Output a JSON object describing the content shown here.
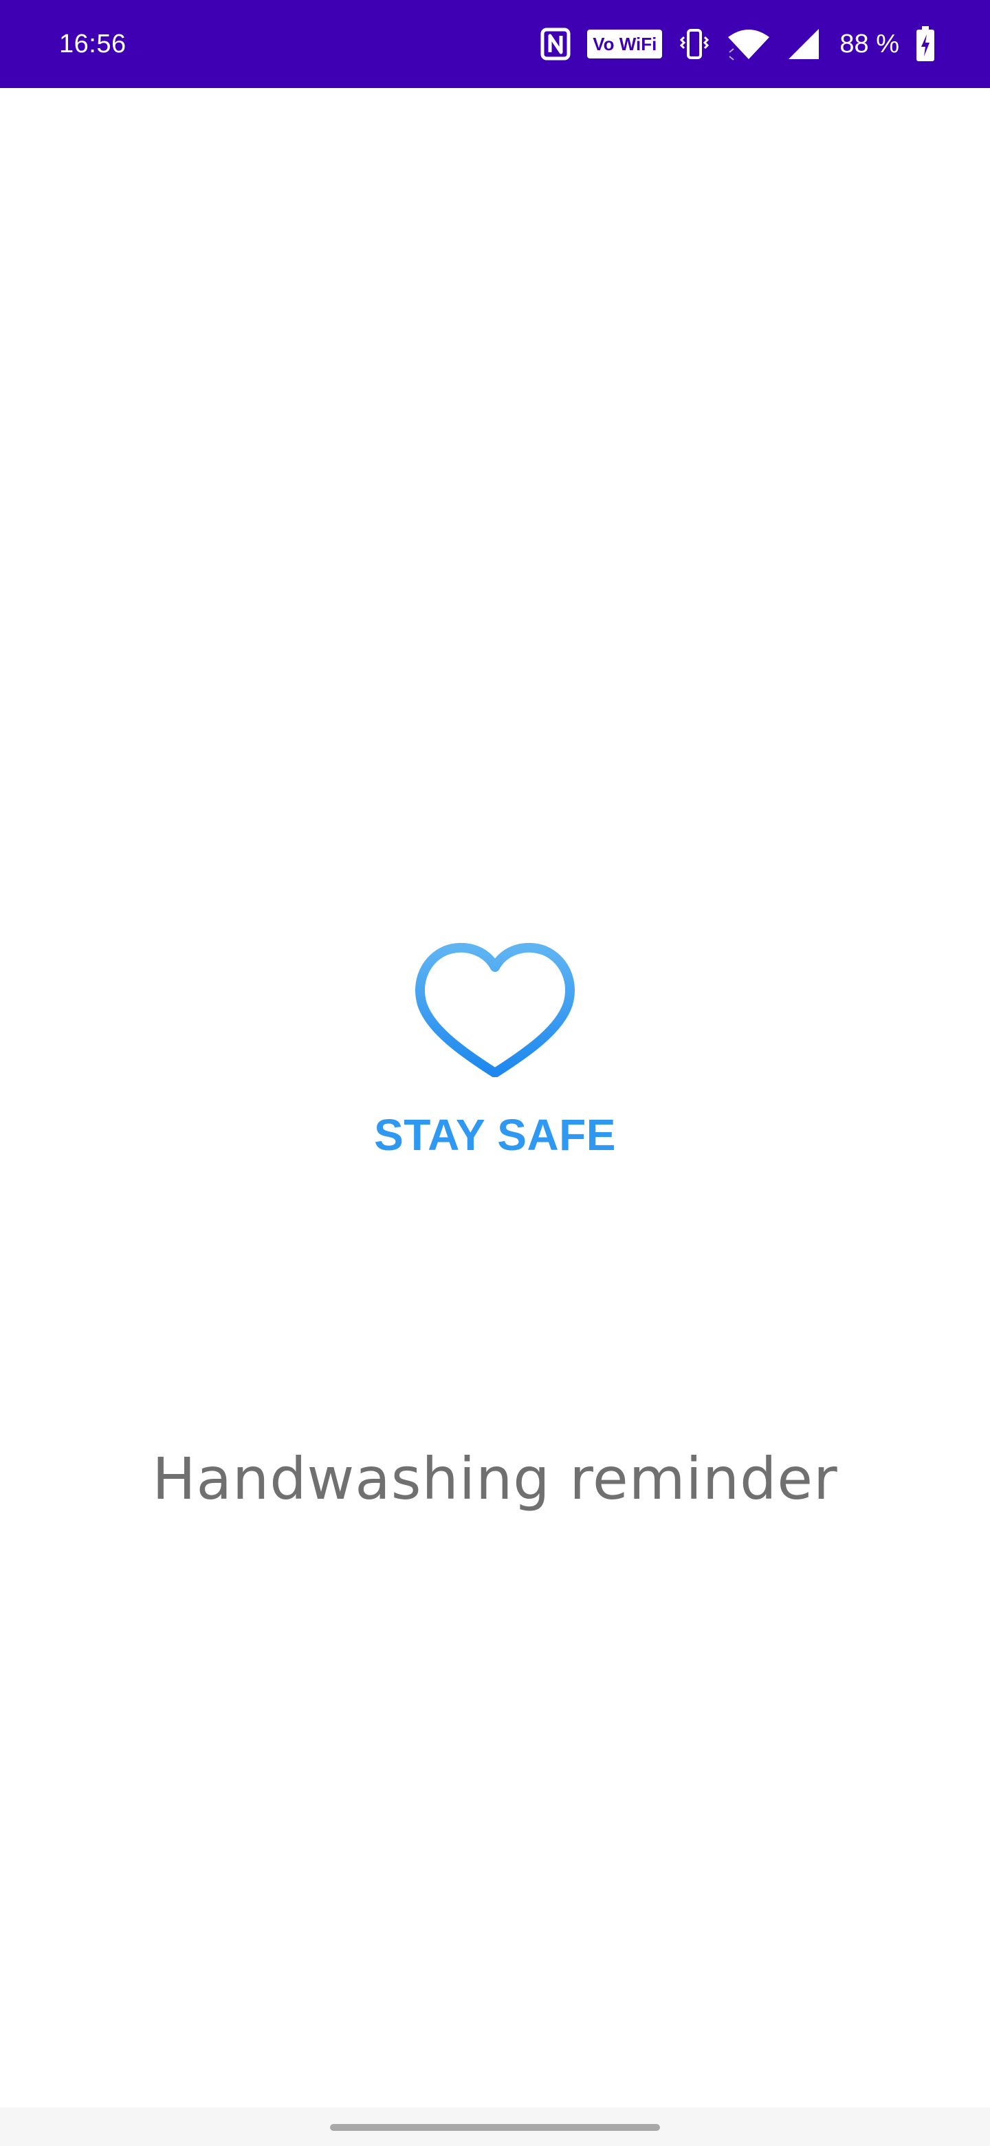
{
  "status_bar": {
    "time": "16:56",
    "vowifi_label": "Vo WiFi",
    "battery_label": "88 %",
    "icons": [
      "nfc-icon",
      "vowifi-icon",
      "vibrate-icon",
      "wifi-icon",
      "signal-icon",
      "battery-charging-icon"
    ],
    "background_color": "#3f00b4"
  },
  "splash": {
    "logo_icon": "heart-icon",
    "brand_text": "STAY SAFE",
    "brand_color": "#2f98f1",
    "app_title": "Handwashing reminder",
    "title_color": "#707070"
  },
  "navigation": {
    "home_indicator": "home-indicator"
  }
}
